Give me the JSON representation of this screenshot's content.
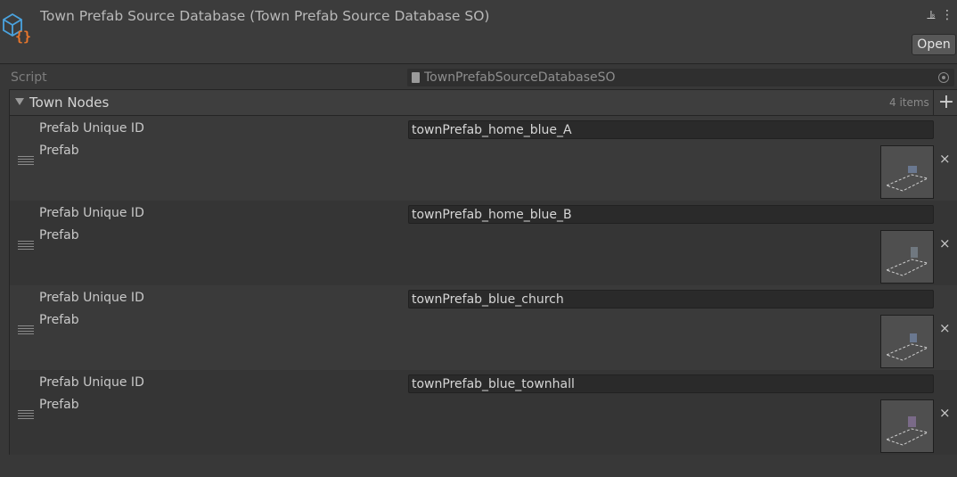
{
  "header": {
    "title": "Town Prefab Source Database (Town Prefab Source Database SO)",
    "open_label": "Open",
    "icon": "scriptable-object-icon",
    "tools": [
      "settings-sliders-icon",
      "more-vert-icon"
    ]
  },
  "script_row": {
    "label": "Script",
    "value": "TownPrefabSourceDatabaseSO"
  },
  "list": {
    "title": "Town Nodes",
    "count": "4 items",
    "add_label": "+",
    "items": [
      {
        "id_label": "Prefab Unique ID",
        "prefab_label": "Prefab",
        "id_value": "townPrefab_home_blue_A"
      },
      {
        "id_label": "Prefab Unique ID",
        "prefab_label": "Prefab",
        "id_value": "townPrefab_home_blue_B"
      },
      {
        "id_label": "Prefab Unique ID",
        "prefab_label": "Prefab",
        "id_value": "townPrefab_blue_church"
      },
      {
        "id_label": "Prefab Unique ID",
        "prefab_label": "Prefab",
        "id_value": "townPrefab_blue_townhall"
      }
    ],
    "remove_label": "×"
  },
  "colors": {
    "background": "#383838",
    "field": "#2a2a2a",
    "icon_blue": "#4aa3df",
    "icon_orange": "#e8762c"
  }
}
